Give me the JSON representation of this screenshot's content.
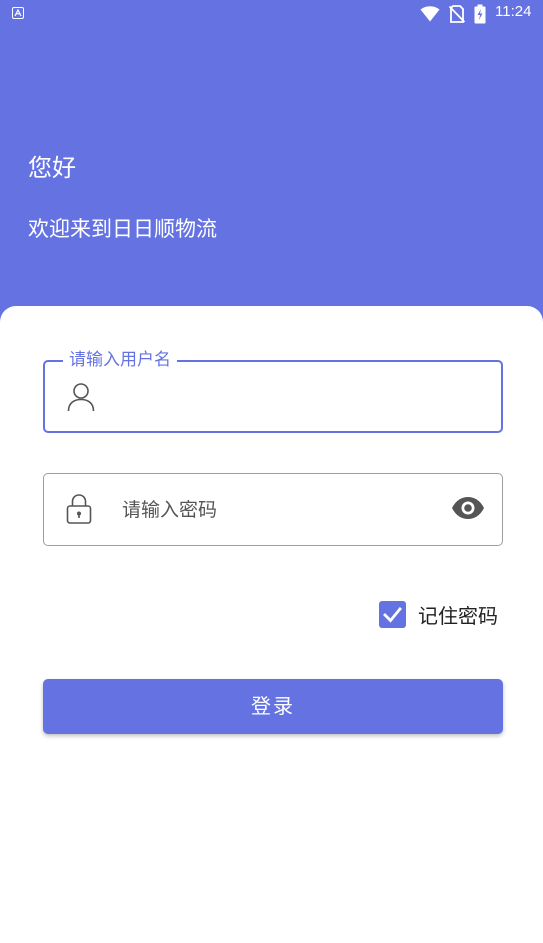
{
  "status_bar": {
    "time": "11:24",
    "app_icon": "a-icon",
    "icons": [
      "wifi-icon",
      "no-sim-icon",
      "battery-charging-icon"
    ]
  },
  "header": {
    "greeting": "您好",
    "welcome": "欢迎来到日日顺物流"
  },
  "login_form": {
    "username": {
      "label": "请输入用户名",
      "value": "",
      "icon": "user-icon"
    },
    "password": {
      "placeholder": "请输入密码",
      "value": "",
      "icon": "lock-icon",
      "toggle_icon": "eye-icon"
    },
    "remember": {
      "label": "记住密码",
      "checked": true
    },
    "submit_label": "登录"
  },
  "colors": {
    "primary": "#6573e2",
    "background": "#ffffff",
    "text": "#222222",
    "border_inactive": "#9e9e9e"
  }
}
